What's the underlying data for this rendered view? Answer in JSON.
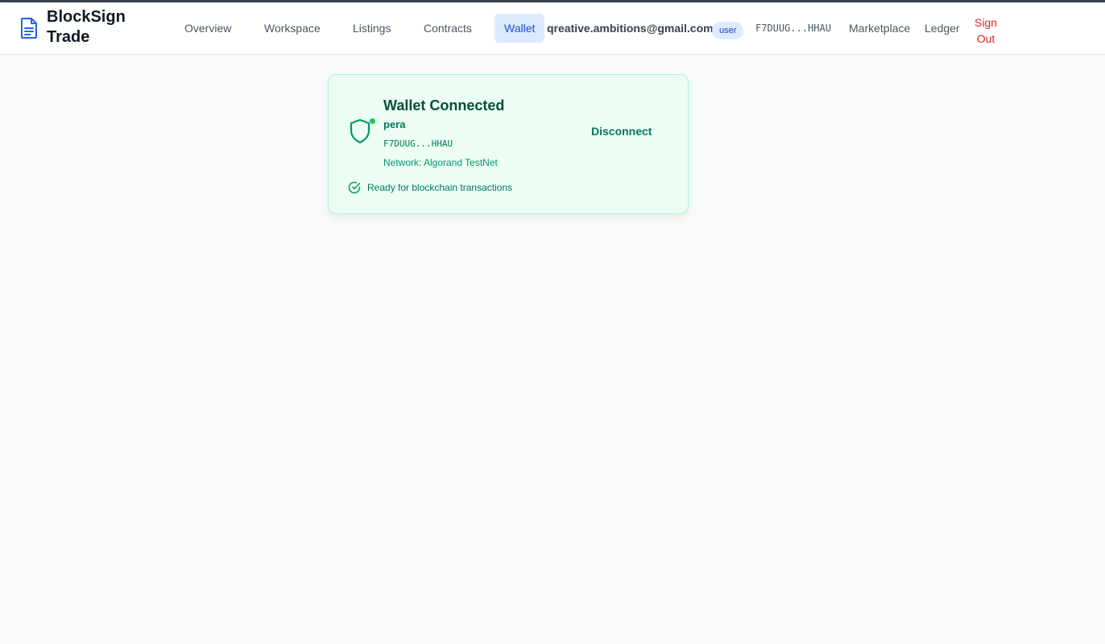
{
  "header": {
    "brand": "BlockSign Trade",
    "brand_icon": "document-icon",
    "nav": [
      {
        "label": "Overview",
        "active": false
      },
      {
        "label": "Workspace",
        "active": false
      },
      {
        "label": "Listings",
        "active": false
      },
      {
        "label": "Contracts",
        "active": false
      },
      {
        "label": "Wallet",
        "active": true
      }
    ],
    "user_email": "qreative.ambitions@gmail.com",
    "role": "user",
    "wallet_short": "F7DUUG...HHAU",
    "links": [
      "Marketplace",
      "Ledger"
    ],
    "sign_out": "Sign Out"
  },
  "wallet_card": {
    "title": "Wallet Connected",
    "provider": "pera",
    "address": "F7DUUG...HHAU",
    "network": "Network: Algorand TestNet",
    "disconnect_label": "Disconnect",
    "status_text": "Ready for blockchain transactions",
    "icon": "shield-icon",
    "status_icon": "check-circle-icon"
  },
  "colors": {
    "accent": "#1d4ed8",
    "success": "#059669",
    "success_bg": "#ecfdf3",
    "danger": "#dc2626"
  }
}
